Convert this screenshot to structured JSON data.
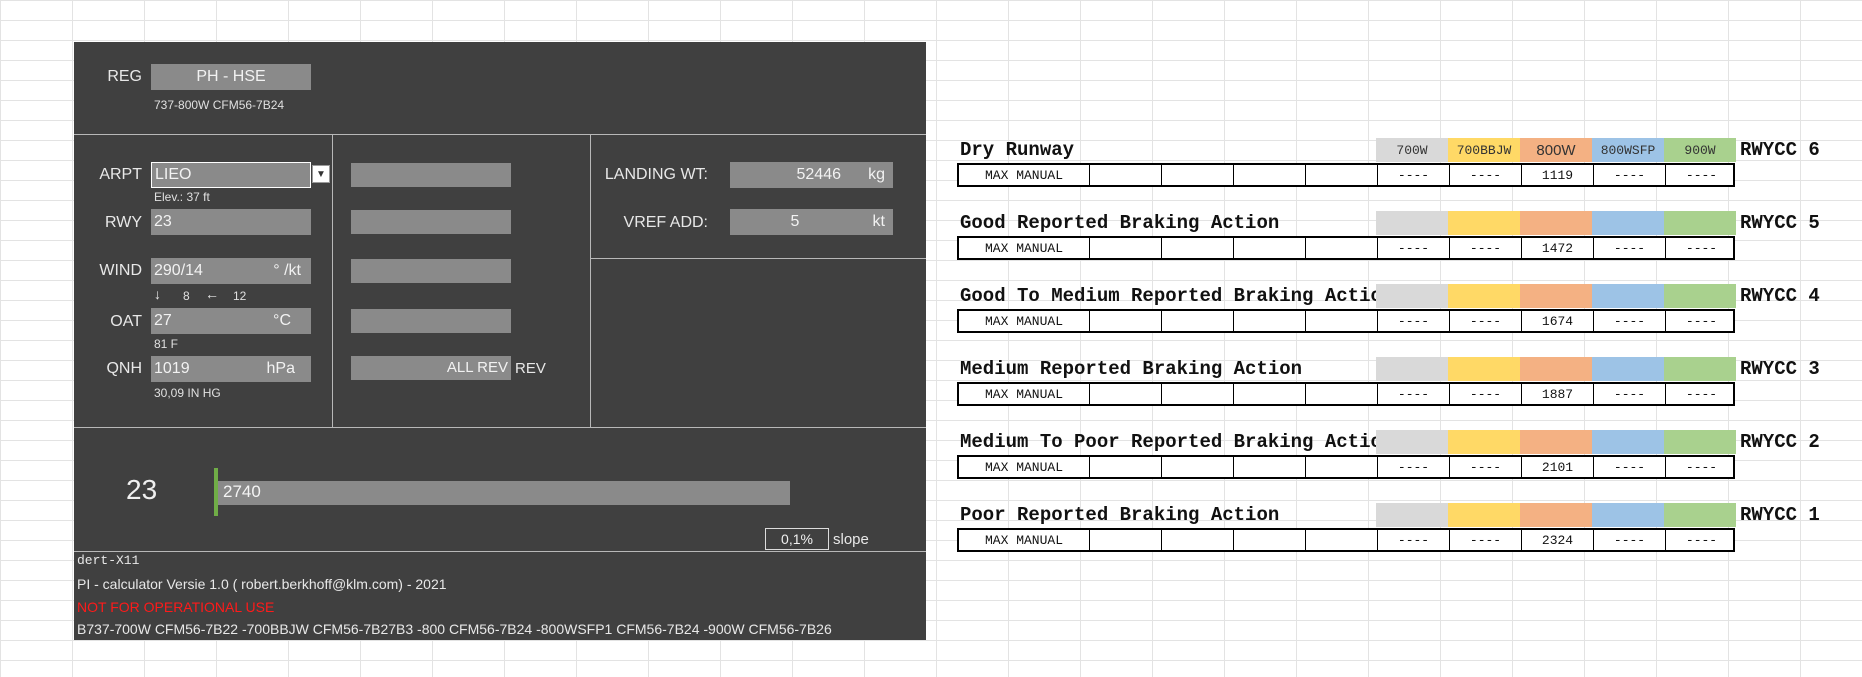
{
  "aircraft": {
    "reg_label": "REG",
    "reg_value": "PH -  HSE",
    "type": "737-800W CFM56-7B24"
  },
  "airport": {
    "arpt_label": "ARPT",
    "arpt_value": "LIEO",
    "elevation": "Elev.: 37 ft",
    "rwy_label": "RWY",
    "rwy_value": "23",
    "wind_label": "WIND",
    "wind_value": "290/14",
    "wind_unit": "° /kt",
    "headwind": "8",
    "crosswind": "12",
    "oat_label": "OAT",
    "oat_value": "27",
    "oat_unit": "°C",
    "oat_f": "81 F",
    "qnh_label": "QNH",
    "qnh_value": "1019",
    "qnh_unit": "hPa",
    "qnh_inhg": "30,09 IN HG"
  },
  "middle": {
    "rev_value": "ALL REV",
    "rev_label": "REV"
  },
  "weights": {
    "landing_wt_label": "LANDING WT:",
    "landing_wt_value": "52446",
    "landing_wt_unit": "kg",
    "vref_label": "VREF ADD:",
    "vref_value": "5",
    "vref_unit": "kt"
  },
  "runway_bar": {
    "rwy": "23",
    "length": "2740",
    "slope_value": "0,1%",
    "slope_label": "slope"
  },
  "footer": {
    "line1": "dert-X11",
    "line2": "PI - calculator Versie 1.0 ( robert.berkhoff@klm.com) - 2021",
    "warning": "NOT FOR OPERATIONAL USE",
    "line4": "B737-700W CFM56-7B22  -700BBJW CFM56-7B27B3  -800 CFM56-7B24  -800WSFP1 CFM56-7B24  -900W CFM56-7B26"
  },
  "variants": [
    "700W",
    "700BBJW",
    "800W",
    "800WSFP",
    "900W"
  ],
  "conditions": [
    {
      "title": "Dry Runway",
      "rwycc": "RWYCC 6",
      "label": "MAX MANUAL",
      "values": [
        "----",
        "----",
        "1119",
        "----",
        "----"
      ]
    },
    {
      "title": "Good Reported Braking Action",
      "rwycc": "RWYCC 5",
      "label": "MAX MANUAL",
      "values": [
        "----",
        "----",
        "1472",
        "----",
        "----"
      ]
    },
    {
      "title": "Good To Medium Reported Braking Action",
      "rwycc": "RWYCC 4",
      "label": "MAX MANUAL",
      "values": [
        "----",
        "----",
        "1674",
        "----",
        "----"
      ]
    },
    {
      "title": "Medium Reported Braking Action",
      "rwycc": "RWYCC 3",
      "label": "MAX MANUAL",
      "values": [
        "----",
        "----",
        "1887",
        "----",
        "----"
      ]
    },
    {
      "title": "Medium To Poor Reported Braking Action",
      "rwycc": "RWYCC 2",
      "label": "MAX MANUAL",
      "values": [
        "----",
        "----",
        "2101",
        "----",
        "----"
      ]
    },
    {
      "title": "Poor Reported Braking Action",
      "rwycc": "RWYCC 1",
      "label": "MAX MANUAL",
      "values": [
        "----",
        "----",
        "2324",
        "----",
        "----"
      ]
    }
  ],
  "colors": {
    "panel": "#404040",
    "field": "#8a8a8a",
    "warning": "#ff1a1a",
    "runway_marker": "#70ad47"
  }
}
